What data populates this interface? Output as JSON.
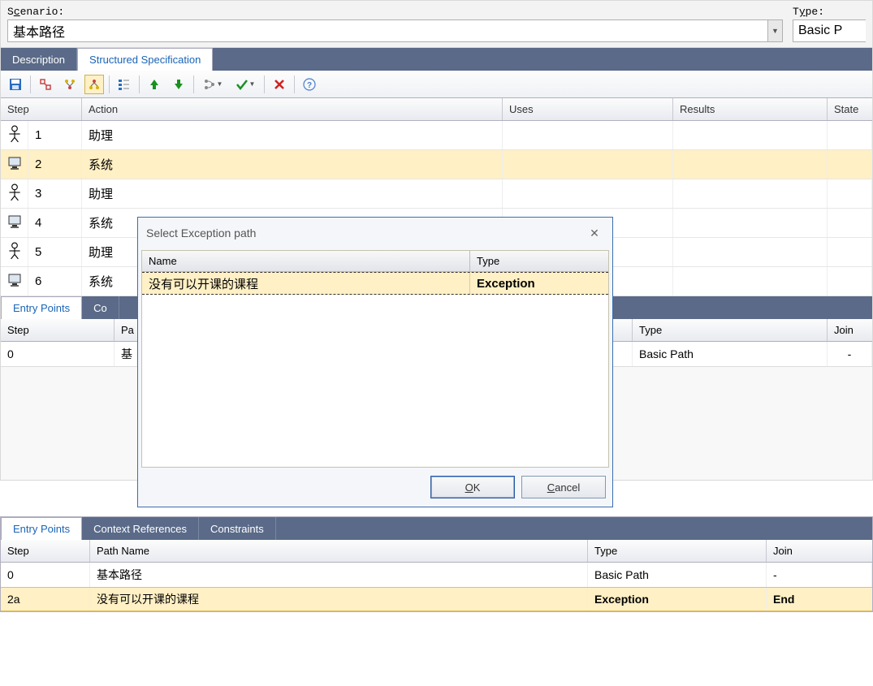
{
  "top": {
    "scenario_label_pre": "S",
    "scenario_label_underline": "c",
    "scenario_label_post": "enario:",
    "scenario_value": "基本路径",
    "type_label": "T",
    "type_label_underline": "y",
    "type_label_post": "pe:",
    "type_value": "Basic P"
  },
  "tabs": {
    "description": "Description",
    "structured": "Structured Specification"
  },
  "grid_headers": {
    "step": "Step",
    "action": "Action",
    "uses": "Uses",
    "results": "Results",
    "state": "State"
  },
  "steps": [
    {
      "icon": "actor",
      "num": "1",
      "action": "助理"
    },
    {
      "icon": "system",
      "num": "2",
      "action": "系统"
    },
    {
      "icon": "actor",
      "num": "3",
      "action": "助理"
    },
    {
      "icon": "system",
      "num": "4",
      "action": "系统"
    },
    {
      "icon": "actor",
      "num": "5",
      "action": "助理"
    },
    {
      "icon": "system",
      "num": "6",
      "action": "系统"
    }
  ],
  "mid_tabs": {
    "entry_points": "Entry Points",
    "context_short": "Co"
  },
  "mid_headers": {
    "step": "Step",
    "path_prefix": "Pa",
    "type": "Type",
    "join": "Join"
  },
  "mid_row": {
    "step": "0",
    "path_name": "基",
    "type": "Basic Path",
    "join": "-"
  },
  "dialog": {
    "title": "Select Exception path",
    "header_name": "Name",
    "header_type": "Type",
    "row_name": "没有可以开课的课程",
    "row_type": "Exception",
    "ok_pre": "",
    "ok_u": "O",
    "ok_post": "K",
    "cancel_pre": "",
    "cancel_u": "C",
    "cancel_post": "ancel"
  },
  "bottom_tabs": {
    "entry_points": "Entry Points",
    "context_refs": "Context References",
    "constraints": "Constraints"
  },
  "bottom_headers": {
    "step": "Step",
    "path_name": "Path Name",
    "type": "Type",
    "join": "Join"
  },
  "bottom_rows": [
    {
      "step": "0",
      "path_name": "基本路径",
      "type": "Basic Path",
      "join": "-"
    },
    {
      "step": "2a",
      "path_name": "没有可以开课的课程",
      "type": "Exception",
      "join": "End"
    }
  ]
}
